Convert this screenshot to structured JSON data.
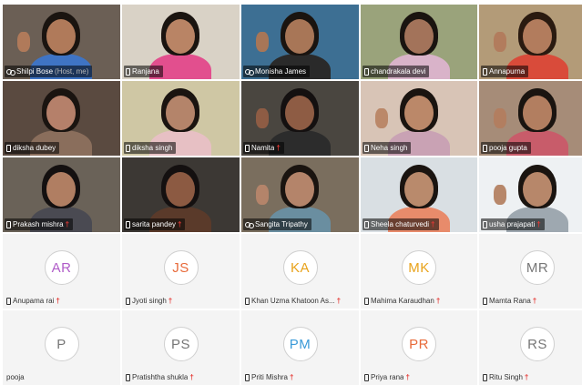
{
  "participants": [
    {
      "name": "Shilpi Bose",
      "host_tag": "(Host, me)",
      "icon": "share-icon",
      "video": true,
      "active": true,
      "muted": false,
      "scene": {
        "bg": "#6b5f55",
        "skin": "#b07a5a",
        "hair": "#1a1410",
        "top": "#3f74c4",
        "hand": true
      }
    },
    {
      "name": "Ranjana",
      "icon": "phone-icon",
      "video": true,
      "muted": false,
      "scene": {
        "bg": "#d9d2c6",
        "skin": "#b98465",
        "hair": "#1a1410",
        "top": "#e24f8e"
      }
    },
    {
      "name": "Monisha James",
      "icon": "share-icon",
      "video": true,
      "active": true,
      "muted": false,
      "scene": {
        "bg": "#3d6f93",
        "skin": "#a87657",
        "hair": "#1a1410",
        "top": "#2a2a2a",
        "hand": true
      }
    },
    {
      "name": "chandrakala devi",
      "icon": "phone-icon",
      "video": true,
      "muted": false,
      "scene": {
        "bg": "#9aa37b",
        "skin": "#a3735a",
        "hair": "#1a1410",
        "top": "#d9b3c9"
      }
    },
    {
      "name": "Annapurna",
      "icon": "phone-icon",
      "video": true,
      "muted": false,
      "scene": {
        "bg": "#b39b78",
        "skin": "#b27c5d",
        "hair": "#2a1a10",
        "top": "#d94b3a",
        "hand": true
      }
    },
    {
      "name": "diksha dubey",
      "icon": "phone-icon",
      "video": true,
      "muted": false,
      "scene": {
        "bg": "#5a4a40",
        "skin": "#b5806a",
        "hair": "#1a1410",
        "top": "#8a6e5c"
      }
    },
    {
      "name": "diksha singh",
      "icon": "phone-icon",
      "video": true,
      "muted": false,
      "scene": {
        "bg": "#cfc7a4",
        "skin": "#b4846a",
        "hair": "#1a1410",
        "top": "#e7c0c4"
      }
    },
    {
      "name": "Namita",
      "icon": "phone-icon",
      "video": true,
      "muted": true,
      "scene": {
        "bg": "#4a4640",
        "skin": "#8e5c44",
        "hair": "#141010",
        "top": "#2c2c2c",
        "hand": true
      }
    },
    {
      "name": "Neha singh",
      "icon": "phone-icon",
      "video": true,
      "muted": false,
      "scene": {
        "bg": "#d8c4b6",
        "skin": "#bb8869",
        "hair": "#1a1410",
        "top": "#c9a2b4",
        "hand": true
      }
    },
    {
      "name": "pooja gupta",
      "icon": "phone-icon",
      "video": true,
      "muted": false,
      "scene": {
        "bg": "#a68c78",
        "skin": "#b27e60",
        "hair": "#1a1410",
        "top": "#c85c6a",
        "hand": true
      }
    },
    {
      "name": "Prakash mishra",
      "icon": "phone-icon",
      "video": true,
      "muted": true,
      "scene": {
        "bg": "#6a6258",
        "skin": "#b07e62",
        "hair": "#141010",
        "top": "#4a4a52"
      }
    },
    {
      "name": "sarita pandey",
      "icon": "phone-icon",
      "video": true,
      "muted": true,
      "scene": {
        "bg": "#3c3834",
        "skin": "#8c5a42",
        "hair": "#141010",
        "top": "#5a3a2a"
      }
    },
    {
      "name": "Sangita Tripathy",
      "icon": "share-icon",
      "video": true,
      "muted": false,
      "scene": {
        "bg": "#7a6e5e",
        "skin": "#b4846a",
        "hair": "#1a1410",
        "top": "#6a8ea0",
        "hand": true
      }
    },
    {
      "name": "Sheela chaturvedi",
      "icon": "phone-icon",
      "video": true,
      "muted": true,
      "scene": {
        "bg": "#d9dfe3",
        "skin": "#b98a6c",
        "hair": "#1a1410",
        "top": "#e88b6b"
      }
    },
    {
      "name": "usha prajapati",
      "icon": "phone-icon",
      "video": true,
      "muted": true,
      "scene": {
        "bg": "#eef1f3",
        "skin": "#b7876a",
        "hair": "#1a1410",
        "top": "#9ea8b0",
        "hand": true
      }
    },
    {
      "name": "Anupama rai",
      "initials": "AR",
      "initials_color": "#b05cc8",
      "icon": "phone-icon",
      "video": false,
      "muted": true
    },
    {
      "name": "Jyoti singh",
      "initials": "JS",
      "initials_color": "#e86a3a",
      "icon": "phone-icon",
      "video": false,
      "muted": true
    },
    {
      "name": "Khan Uzma Khatoon As...",
      "initials": "KA",
      "initials_color": "#e8a21a",
      "icon": "phone-icon",
      "video": false,
      "muted": true
    },
    {
      "name": "Mahima Karaudhan",
      "initials": "MK",
      "initials_color": "#e8a21a",
      "icon": "phone-icon",
      "video": false,
      "muted": true
    },
    {
      "name": "Mamta Rana",
      "initials": "MR",
      "initials_color": "#777777",
      "icon": "phone-icon",
      "video": false,
      "muted": true
    },
    {
      "name": "pooja",
      "initials": "P",
      "initials_color": "#777777",
      "icon": "",
      "video": false,
      "muted": false
    },
    {
      "name": "Pratishtha shukla",
      "initials": "PS",
      "initials_color": "#777777",
      "icon": "phone-icon",
      "video": false,
      "muted": true
    },
    {
      "name": "Priti Mishra",
      "initials": "PM",
      "initials_color": "#3a9ad8",
      "icon": "phone-icon",
      "video": false,
      "muted": true
    },
    {
      "name": "Priya rana",
      "initials": "PR",
      "initials_color": "#e86a3a",
      "icon": "phone-icon",
      "video": false,
      "muted": true
    },
    {
      "name": "Ritu Singh",
      "initials": "RS",
      "initials_color": "#777777",
      "icon": "phone-icon",
      "video": false,
      "muted": true
    }
  ],
  "colors": {
    "active_border": "#4ec3e0",
    "muted_icon": "#e53935"
  }
}
